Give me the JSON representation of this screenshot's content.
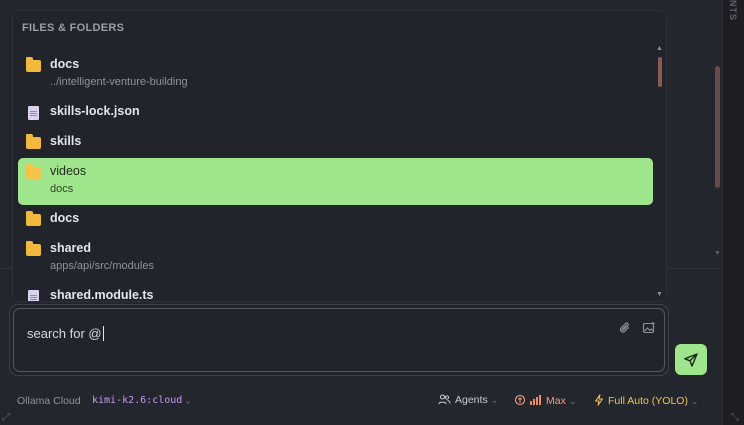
{
  "side_panel_label": "NTS",
  "popup": {
    "header": "FILES & FOLDERS",
    "items": [
      {
        "type": "folder",
        "name": "docs",
        "sub": "../intelligent-venture-building",
        "active": false
      },
      {
        "type": "file",
        "name": "skills-lock.json",
        "sub": "",
        "active": false
      },
      {
        "type": "folder",
        "name": "skills",
        "sub": "",
        "active": false
      },
      {
        "type": "folder",
        "name": "videos",
        "sub": "docs",
        "active": true
      },
      {
        "type": "folder",
        "name": "docs",
        "sub": "",
        "active": false
      },
      {
        "type": "folder",
        "name": "shared",
        "sub": "apps/api/src/modules",
        "active": false
      },
      {
        "type": "file",
        "name": "shared.module.ts",
        "sub": "",
        "active": false
      }
    ]
  },
  "input": {
    "value": "search for @"
  },
  "footer": {
    "provider": "Ollama Cloud",
    "model": "kimi-k2.6:cloud",
    "agents": "Agents",
    "effort": "Max",
    "mode": "Full Auto (YOLO)"
  },
  "colors": {
    "accent_green": "#9fe58b",
    "folder": "#f2b93b",
    "model_text": "#c79bf0",
    "effort_text": "#f39a84",
    "mode_text": "#f4c44e"
  }
}
